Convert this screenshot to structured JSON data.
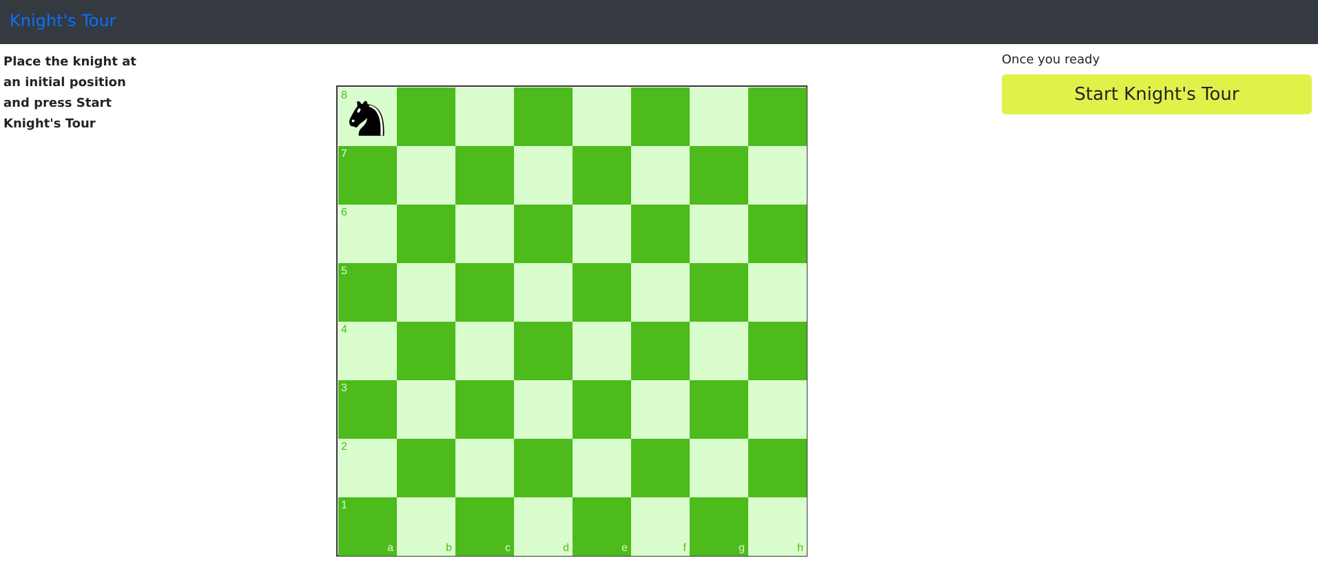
{
  "navbar": {
    "brand": "Knight's Tour"
  },
  "instructions": {
    "text": "Place the knight at an initial position and press Start Knight's Tour"
  },
  "controls": {
    "ready_label": "Once you ready",
    "start_button_label": "Start Knight's Tour"
  },
  "board": {
    "ranks": [
      "8",
      "7",
      "6",
      "5",
      "4",
      "3",
      "2",
      "1"
    ],
    "files": [
      "a",
      "b",
      "c",
      "d",
      "e",
      "f",
      "g",
      "h"
    ],
    "light_color": "#d9fdcd",
    "dark_color": "#4cbb1b",
    "knight_square": "a8",
    "knight_icon": "black-knight-icon"
  },
  "colors": {
    "navbar_bg": "#343a40",
    "brand": "#0d6efd",
    "button_bg": "#e0f24a"
  }
}
